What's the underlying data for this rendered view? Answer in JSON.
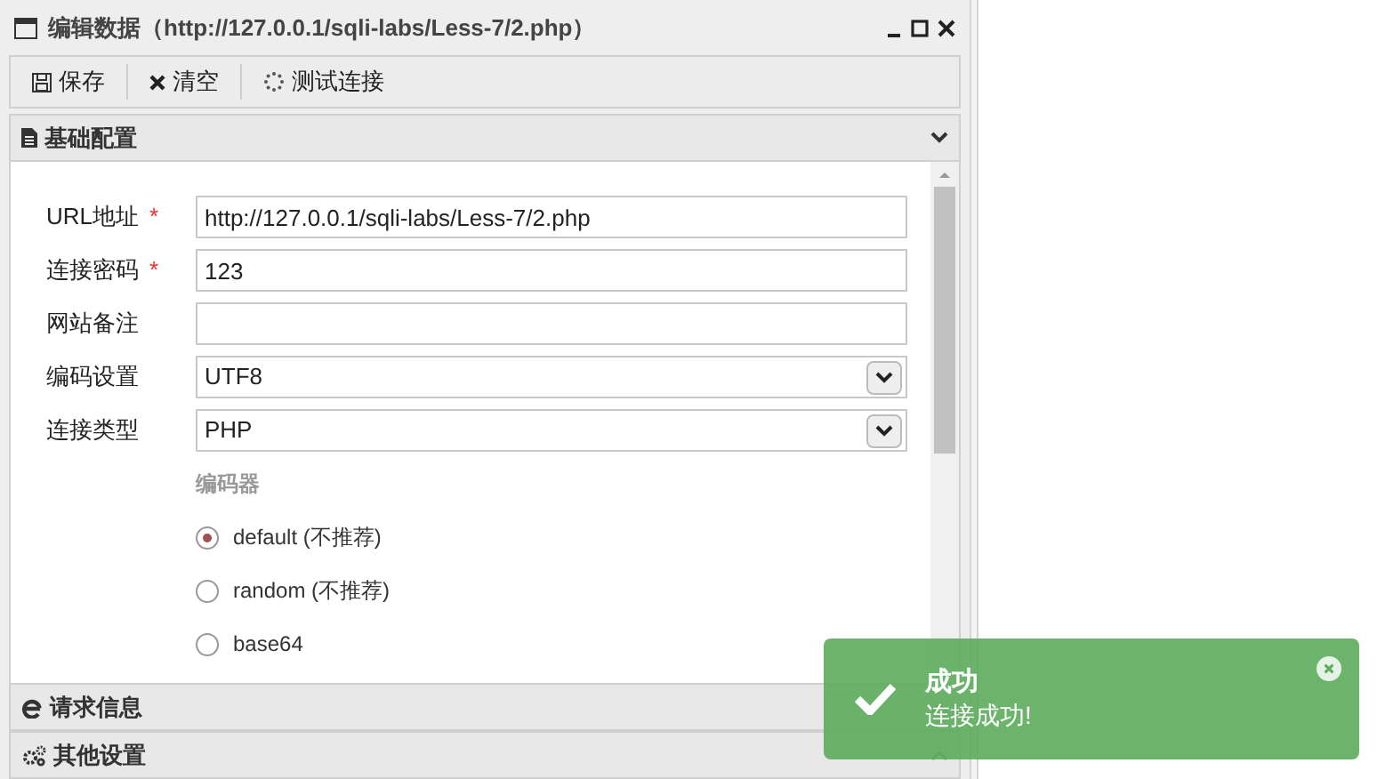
{
  "window": {
    "title": "编辑数据（http://127.0.0.1/sqli-labs/Less-7/2.php）"
  },
  "toolbar": [
    {
      "label": "保存"
    },
    {
      "label": "清空"
    },
    {
      "label": "测试连接"
    }
  ],
  "sections": [
    {
      "title": "基础配置",
      "expanded": true
    },
    {
      "title": "请求信息",
      "expanded": false
    },
    {
      "title": "其他设置",
      "expanded": false
    }
  ],
  "fields": [
    {
      "kind": "text",
      "label": "URL地址",
      "required_mark": "*",
      "value": "http://127.0.0.1/sqli-labs/Less-7/2.php"
    },
    {
      "kind": "text",
      "label": "连接密码",
      "required_mark": "*",
      "value": "123"
    },
    {
      "kind": "text",
      "label": "网站备注"
    },
    {
      "kind": "select",
      "label": "编码设置",
      "value": "UTF8"
    },
    {
      "kind": "select",
      "label": "连接类型",
      "value": "PHP"
    }
  ],
  "encoder": {
    "label": "编码器",
    "options": [
      {
        "label": "default (不推荐)",
        "selected": true
      },
      {
        "label": "random (不推荐)",
        "selected": false
      },
      {
        "label": "base64",
        "selected": false
      }
    ]
  },
  "toast": {
    "title": "成功",
    "message": "连接成功!"
  }
}
